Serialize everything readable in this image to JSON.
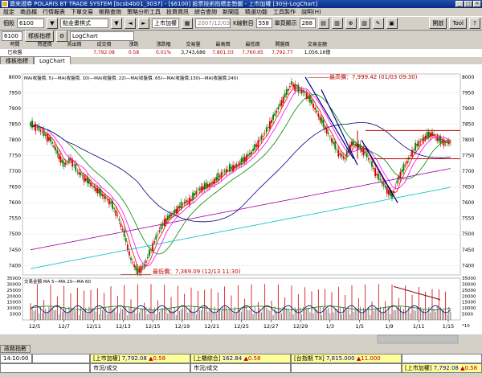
{
  "window": {
    "title": "寶來證券 POLARIS BT TRADE SYSTEM [bcsb4b01_3037] - [$6100] 股票技術指標走勢圖 - 上市加權 [30分-LogChart]"
  },
  "menu": [
    "設定",
    "商品檔",
    "行情報表",
    "下單交易",
    "帳務查詢",
    "策略分析工具",
    "投資資訊",
    "綜合查詢",
    "新聞區",
    "精選功能",
    "工具製作",
    "說明(H)"
  ],
  "toolbar": {
    "watch_label": "個股",
    "symbol_value": "6100",
    "mode_value": "點金畫棋式",
    "period_value": "上市加權",
    "date_value": "2007/12/03",
    "k_count_label": "K線數目",
    "k_count_value": "558",
    "screen_count_label": "單頁顯示",
    "screen_count_value": "288",
    "right_btn1": "開啟",
    "right_btn2": "Tool"
  },
  "toolbar2": {
    "code_value": "6100",
    "indicator_btn": "樣板指標",
    "log_value": "LogChart"
  },
  "info": {
    "headers": [
      "時間",
      "買進價",
      "賣出價",
      "成交價",
      "漲跌",
      "漲跌幅",
      "交易量",
      "最高價",
      "最低價",
      "開盤價",
      "交易金額"
    ],
    "values": [
      "已收盤",
      "",
      "",
      "7,792.08",
      "0.58",
      "0.01%",
      "3,743,686",
      "7,801.03",
      "7,760.65",
      "7,792.77",
      "1,056.16億"
    ]
  },
  "tabs": [
    "樣板指標",
    "LogChart"
  ],
  "chart_data": [
    {
      "type": "line",
      "title": "MA(收盤價, 5)—MA(收盤價, 10)—MA(收盤價, 22)—MA(收盤價, 65)—MA(收盤價,130)—MA(收盤價,240)",
      "ylim": [
        7370,
        8010
      ],
      "y_ticks": [
        7400,
        7450,
        7500,
        7550,
        7600,
        7650,
        7700,
        7750,
        7800,
        7850,
        7900,
        7950,
        8000
      ],
      "x_ticks": [
        "12/5",
        "12/7",
        "12/11",
        "12/13",
        "12/15",
        "12/19",
        "12/21",
        "12/25",
        "12/27",
        "12/29",
        "1/3",
        "1/5",
        "1/9",
        "1/11",
        "1/15"
      ],
      "annotations": {
        "high": "最高價：7,999.42 (01/03 09:30)",
        "low": "最低價：7,369.09 (12/13 11:30)"
      },
      "series_prices": [
        7850,
        7840,
        7820,
        7800,
        7760,
        7720,
        7740,
        7700,
        7680,
        7660,
        7640,
        7620,
        7600,
        7560,
        7500,
        7420,
        7380,
        7400,
        7450,
        7500,
        7540,
        7560,
        7580,
        7600,
        7610,
        7640,
        7650,
        7660,
        7680,
        7700,
        7710,
        7720,
        7740,
        7760,
        7790,
        7820,
        7860,
        7900,
        7940,
        7980,
        7960,
        7950,
        7920,
        7880,
        7840,
        7800,
        7760,
        7740,
        7790,
        7780,
        7760,
        7720,
        7680,
        7650,
        7620,
        7680,
        7720,
        7760,
        7790,
        7810,
        7820,
        7800,
        7792
      ]
    },
    {
      "type": "bar",
      "title": "交易金額 MA 5—MA 20—MA 60",
      "ylim": [
        0,
        35000
      ],
      "y_ticks": [
        5000,
        10000,
        15000,
        20000,
        25000,
        30000,
        35000
      ],
      "unit": "10"
    }
  ],
  "status": {
    "row1_label": "政務指數",
    "row2": {
      "time": "14:10:00",
      "index_name": "[上市加權]",
      "index_value": "7,792.08",
      "index_change": "0.58",
      "tse_turnover_name": "[上櫃綜合]",
      "tse_turnover_value": "162.84",
      "tse_change": "0.58",
      "futures_name": "[台指期 TX]",
      "futures_value": "7,815.000",
      "futures_change": "11.000"
    },
    "row3": {
      "empty1": "",
      "market_label": "市況/成交",
      "market2_label": "市況/成交",
      "index_name": "[上市加權]",
      "index_value": "7,792.08",
      "index_change": "0.58"
    }
  }
}
